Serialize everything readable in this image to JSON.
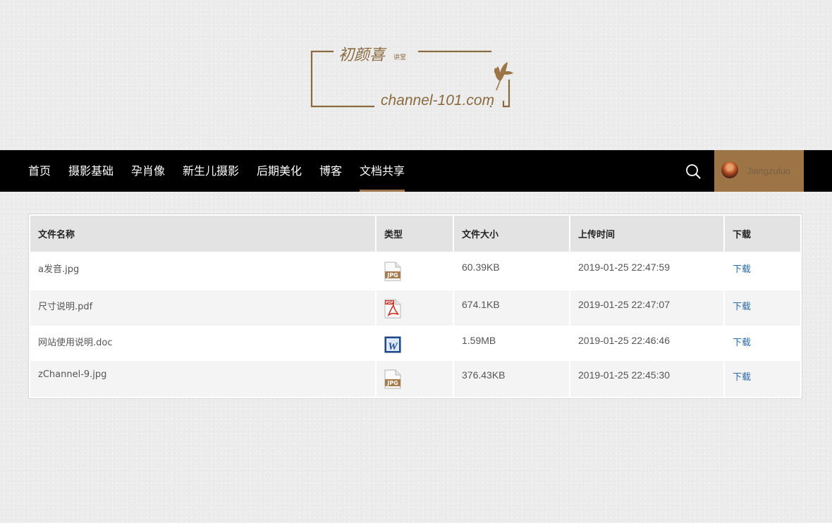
{
  "brand": {
    "name_cn": "初颜喜",
    "name_small": "讲堂",
    "url": "channel-101.com"
  },
  "nav": {
    "items": [
      "首页",
      "摄影基础",
      "孕肖像",
      "新生儿摄影",
      "后期美化",
      "博客",
      "文档共享"
    ],
    "active": "文档共享"
  },
  "user": {
    "name": "Jiangzuluo"
  },
  "table": {
    "headers": [
      "文件名称",
      "类型",
      "文件大小",
      "上传时间",
      "下载"
    ],
    "rows": [
      {
        "name": "a发音.jpg",
        "type_icon": "jpg-file-icon",
        "size": "60.39KB",
        "time": "2019-01-25 22:47:59",
        "download": "下载"
      },
      {
        "name": "尺寸说明.pdf",
        "type_icon": "pdf-file-icon",
        "size": "674.1KB",
        "time": "2019-01-25 22:47:07",
        "download": "下载"
      },
      {
        "name": "网站使用说明.doc",
        "type_icon": "word-file-icon",
        "size": "1.59MB",
        "time": "2019-01-25 22:46:46",
        "download": "下载"
      },
      {
        "name": "zChannel-9.jpg",
        "type_icon": "jpg-file-icon",
        "size": "376.43KB",
        "time": "2019-01-25 22:45:30",
        "download": "下载"
      }
    ]
  },
  "colors": {
    "accent": "#9c7445",
    "nav_bg": "#000000",
    "link": "#2a6aa8"
  }
}
